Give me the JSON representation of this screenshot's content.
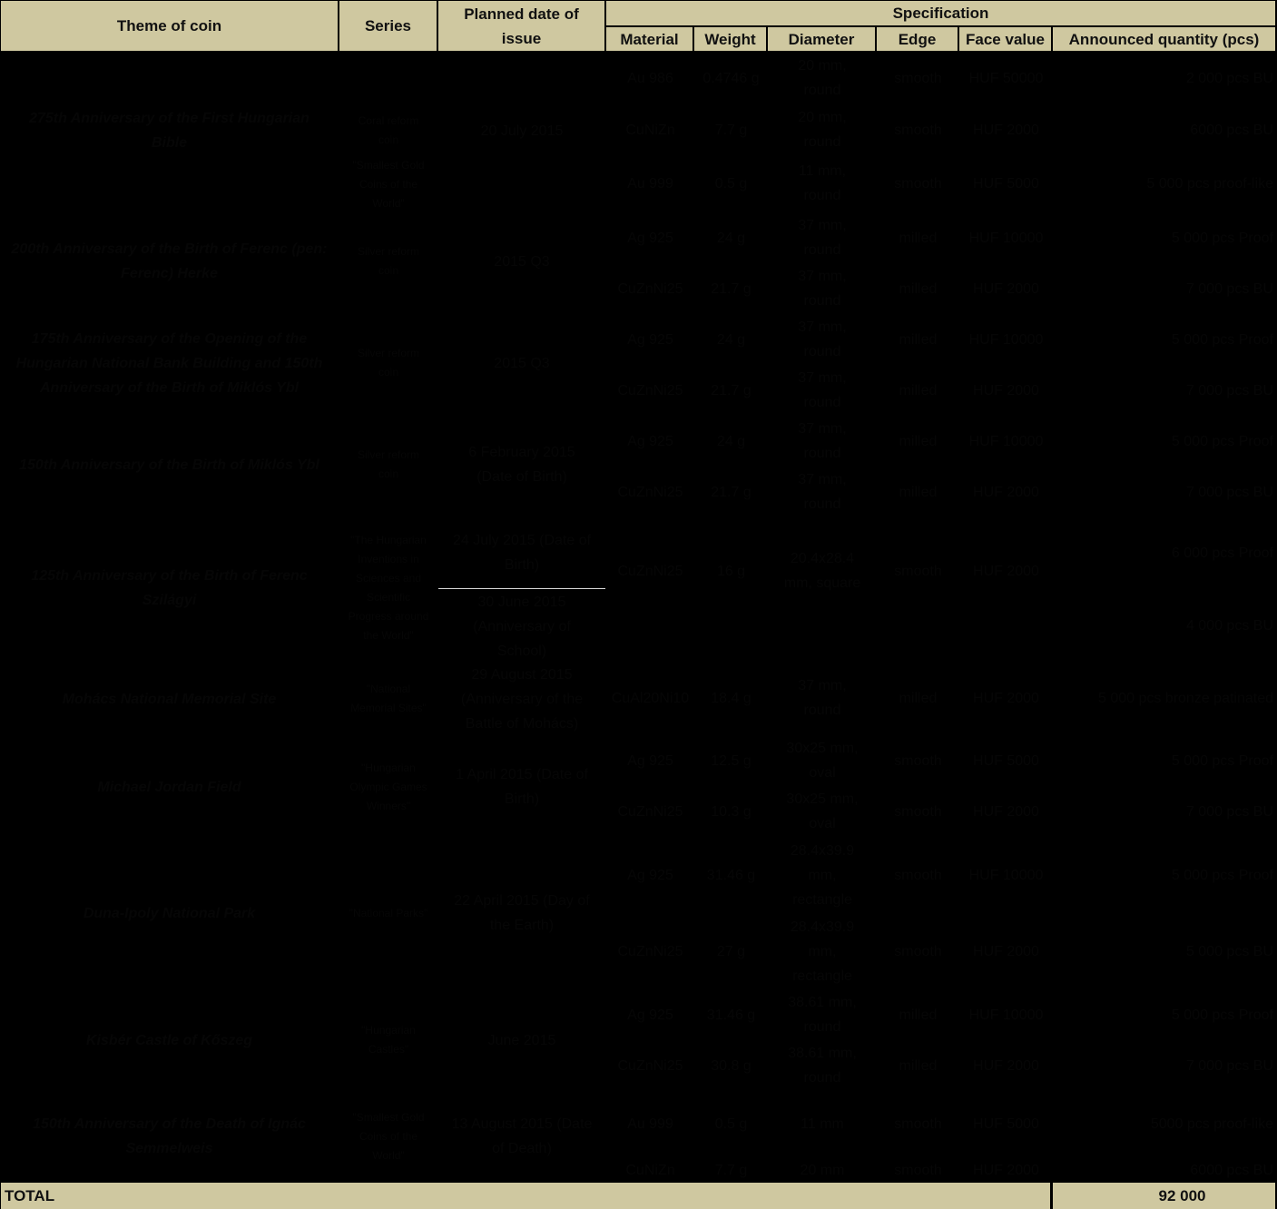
{
  "header": {
    "theme": "Theme of coin",
    "series": "Series",
    "date": "Planned date of issue",
    "spec": "Specification",
    "material": "Material",
    "weight": "Weight",
    "diameter": "Diameter",
    "edge": "Edge",
    "face_value": "Face value",
    "quantity": "Announced quantity (pcs)"
  },
  "colors": {
    "header_bg": "#cfc8a0",
    "body_bg": "#000000",
    "text": "#111111"
  },
  "groups": [
    {
      "theme": "275th Anniversary of the First Hungarian Bible",
      "series": "Coral reform coin",
      "date": "20 July 2015"
    },
    {
      "series2": "\"Smallest Gold Coins of the World\""
    },
    {
      "theme": "200th Anniversary of the Birth of Ferenc (pen: Ferenc) Herke",
      "series": "Silver reform coin",
      "date": "2015 Q3"
    },
    {
      "theme": "175th Anniversary of the Opening of the Hungarian National Bank Building and 150th Anniversary of the Birth of Miklós Ybl",
      "series": "Silver reform coin",
      "date": "2015 Q3"
    },
    {
      "theme": "150th Anniversary of the Birth of Miklós Ybl",
      "series": "Silver reform coin",
      "date": "6 February 2015 (Date of Birth)"
    },
    {
      "theme": "125th Anniversary of the Birth of Ferenc Szilágyi",
      "series": "\"The Hungarian Inventions in Sciences and Scientific Progress around the World\"",
      "date": "24 July 2015 (Date of Birth)",
      "date2": "30 June 2015 (Anniversary of School)"
    },
    {
      "theme": "Mohács National Memorial Site",
      "series": "\"National Memorial Sites\"",
      "date": "29 August 2015 (Anniversary of the Battle of Mohács)"
    },
    {
      "theme": "Michael Jordan Field",
      "series": "\"Hungarian Olympic Games Winners\"",
      "date": "1 April 2015 (Date of Birth)"
    },
    {
      "theme": "Duna-Ipoly National Park",
      "series": "\"National Parks\"",
      "date": "22 April 2015 (Day of the Earth)"
    },
    {
      "theme": "Kisbér Castle of Kőszeg",
      "series": "\"Hungarian Castles\"",
      "date": "June 2015"
    },
    {
      "theme": "150th Anniversary of the Death of Ignác Semmelweis",
      "series": "\"Smallest Gold Coins of the World\"",
      "date": "13 August 2015 (Date of Death)"
    }
  ],
  "rows": [
    {
      "material": "Au 986",
      "weight": "0.4746 g",
      "diameter": "20 mm, round",
      "edge": "smooth",
      "face_value": "HUF 50000",
      "quantity": "2 000 pcs BU"
    },
    {
      "material": "CuNiZn",
      "weight": "7.7 g",
      "diameter": "20 mm, round",
      "edge": "smooth",
      "face_value": "HUF 2000",
      "quantity": "6000 pcs BU"
    },
    {
      "material": "Au 999",
      "weight": "0.5 g",
      "diameter": "11 mm, round",
      "edge": "smooth",
      "face_value": "HUF 5000",
      "quantity": "5 000 pcs proof-like"
    },
    {
      "material": "Ag 925",
      "weight": "24 g",
      "diameter": "37 mm, round",
      "edge": "milled",
      "face_value": "HUF 10000",
      "quantity": "5 000 pcs Proof"
    },
    {
      "material": "CuZnNi25",
      "weight": "21.7 g",
      "diameter": "37 mm, round",
      "edge": "milled",
      "face_value": "HUF 2000",
      "quantity": "7 000 pcs BU"
    },
    {
      "material": "Ag 925",
      "weight": "24 g",
      "diameter": "37 mm, round",
      "edge": "milled",
      "face_value": "HUF 10000",
      "quantity": "5 000 pcs Proof"
    },
    {
      "material": "CuZnNi25",
      "weight": "21.7 g",
      "diameter": "37 mm, round",
      "edge": "milled",
      "face_value": "HUF 2000",
      "quantity": "7 000 pcs BU"
    },
    {
      "material": "Ag 925",
      "weight": "24 g",
      "diameter": "37 mm, round",
      "edge": "milled",
      "face_value": "HUF 10000",
      "quantity": "5 000 pcs Proof"
    },
    {
      "material": "CuZnNi25",
      "weight": "21.7 g",
      "diameter": "37 mm, round",
      "edge": "milled",
      "face_value": "HUF 2000",
      "quantity": "7 000 pcs BU"
    },
    {
      "material": "CuZnNi25",
      "weight": "16 g",
      "diameter": "20.4x28.4 mm, square",
      "edge": "smooth",
      "face_value": "HUF 2000",
      "quantity": "6 000 pcs Proof",
      "quantity2": "4 000 pcs BU"
    },
    {
      "material": "CuAl20Ni10",
      "weight": "18.4 g",
      "diameter": "37 mm, round",
      "edge": "milled",
      "face_value": "HUF 2000",
      "quantity": "5 000 pcs bronze patinated"
    },
    {
      "material": "Ag 925",
      "weight": "12.5 g",
      "diameter": "30x25 mm, oval",
      "edge": "smooth",
      "face_value": "HUF 5000",
      "quantity": "5 000 pcs Proof"
    },
    {
      "material": "CuZnNi25",
      "weight": "10.3 g",
      "diameter": "30x25 mm, oval",
      "edge": "smooth",
      "face_value": "HUF 2000",
      "quantity": "7 000 pcs BU"
    },
    {
      "material": "Ag 925",
      "weight": "31.46 g",
      "diameter": "28.4x39.9 mm, rectangle",
      "edge": "smooth",
      "face_value": "HUF 10000",
      "quantity": "5 000 pcs Proof"
    },
    {
      "material": "CuZnNi25",
      "weight": "27 g",
      "diameter": "28.4x39.9 mm, rectangle",
      "edge": "smooth",
      "face_value": "HUF 2000",
      "quantity": "5 000 pcs BU"
    },
    {
      "material": "Ag 925",
      "weight": "31.46 g",
      "diameter": "38.61 mm, round",
      "edge": "milled",
      "face_value": "HUF 10000",
      "quantity": "5 000 pcs Proof"
    },
    {
      "material": "CuZnNi25",
      "weight": "30.8 g",
      "diameter": "38.61 mm, round",
      "edge": "milled",
      "face_value": "HUF 2000",
      "quantity": "7 000 pcs BU"
    },
    {
      "material": "Au 999",
      "weight": "0.5 g",
      "diameter": "11 mm",
      "edge": "smooth",
      "face_value": "HUF 5000",
      "quantity": "5000 pcs proof-like"
    },
    {
      "material": "CuNiZn",
      "weight": "7.7 g",
      "diameter": "20 mm",
      "edge": "smooth",
      "face_value": "HUF 2000",
      "quantity": "6000 pcs BU"
    }
  ],
  "total": {
    "label": "TOTAL",
    "value": "92 000"
  }
}
